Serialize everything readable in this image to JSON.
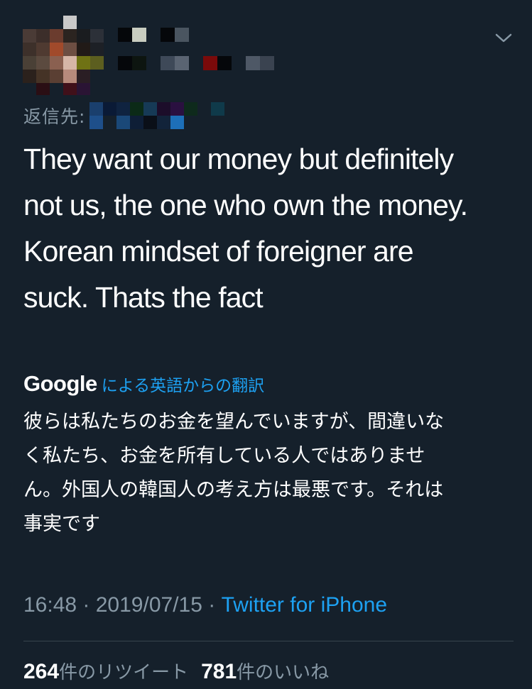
{
  "tweet": {
    "reply_to_label": "返信先:",
    "text": "They want our money but definitely\nnot us, the one who own the money.\nKorean mindset of foreigner are\nsuck. Thats the fact"
  },
  "translation": {
    "provider": "Google",
    "label": "による英語からの翻訳",
    "text": "彼らは私たちのお金を望んでいますが、間違いな\nく私たち、お金を所有している人ではありませ\nん。外国人の韓国人の考え方は最悪です。それは\n事実です"
  },
  "meta": {
    "time": "16:48",
    "date": "2019/07/15",
    "separator": " · ",
    "source": "Twitter for iPhone"
  },
  "stats": {
    "retweets_count": "264",
    "retweets_label": "件のリツイート",
    "likes_count": "781",
    "likes_label": "件のいいね"
  },
  "icons": {
    "menu": "chevron-down-icon"
  },
  "colors": {
    "background": "#15202b",
    "text": "#ffffff",
    "secondary": "#8899a6",
    "accent": "#1da1f2",
    "divider": "#38444d"
  }
}
